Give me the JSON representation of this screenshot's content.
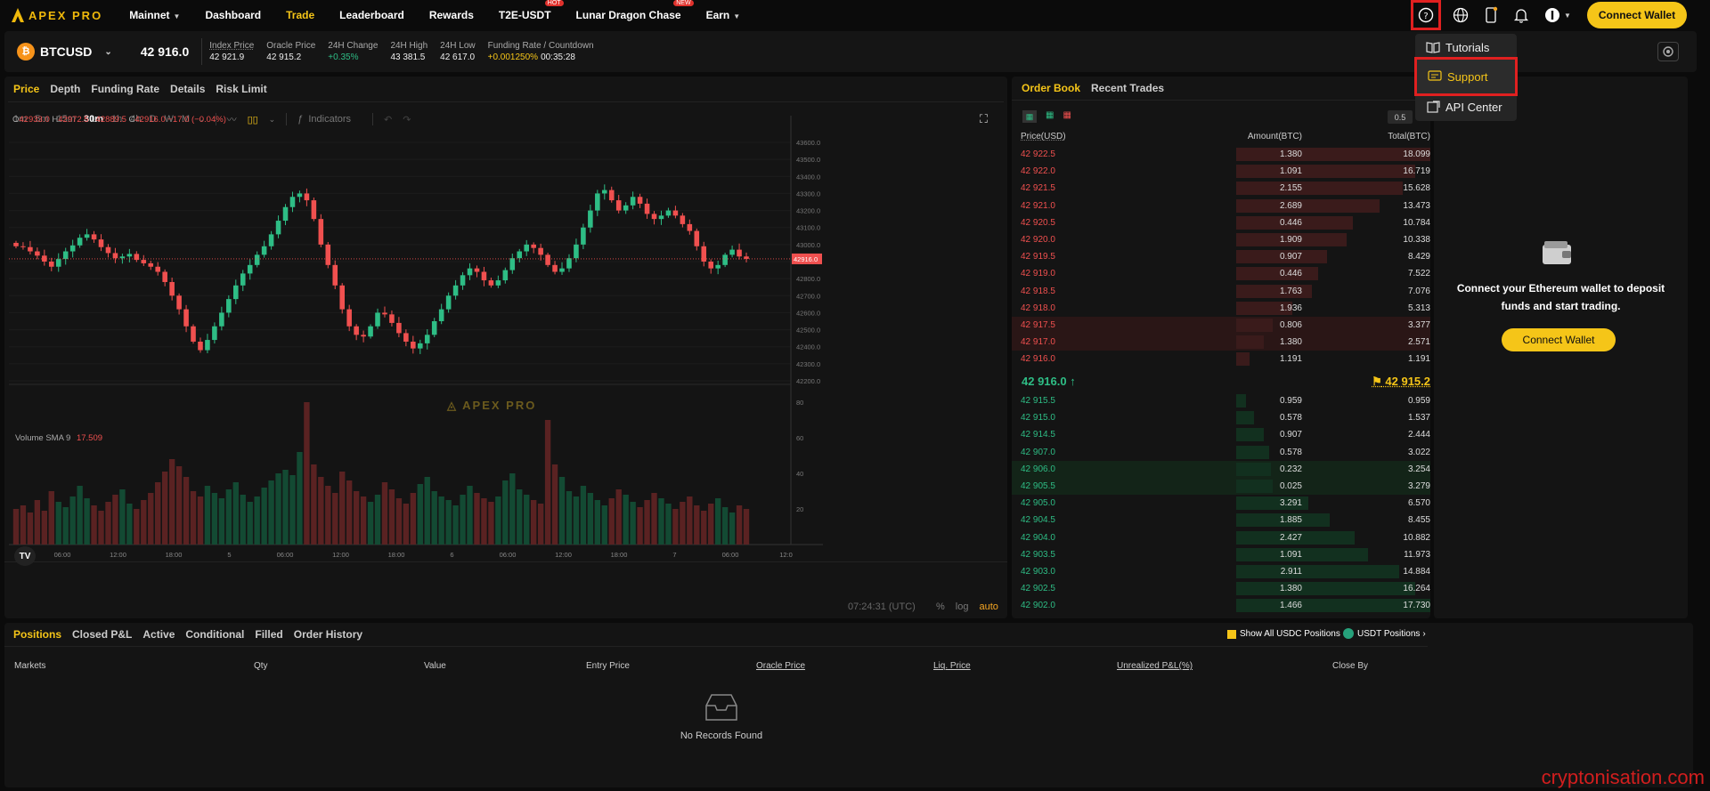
{
  "nav": {
    "logo": "APEX PRO",
    "items": [
      {
        "label": "Mainnet",
        "caret": true,
        "tag": ""
      },
      {
        "label": "Dashboard",
        "caret": false,
        "tag": ""
      },
      {
        "label": "Trade",
        "caret": false,
        "tag": "",
        "active": true
      },
      {
        "label": "Leaderboard",
        "caret": false,
        "tag": ""
      },
      {
        "label": "Rewards",
        "caret": false,
        "tag": ""
      },
      {
        "label": "T2E-USDT",
        "caret": false,
        "tag": "HOT"
      },
      {
        "label": "Lunar Dragon Chase",
        "caret": false,
        "tag": "NEW"
      },
      {
        "label": "Earn",
        "caret": true,
        "tag": ""
      }
    ],
    "connect_label": "Connect Wallet",
    "icons": [
      "help-icon",
      "globe-icon",
      "mobile-icon",
      "bell-icon",
      "account-icon"
    ]
  },
  "dropdown": {
    "items": [
      {
        "label": "Tutorials",
        "icon": "book-icon"
      },
      {
        "label": "Support",
        "icon": "message-icon",
        "highlighted": true
      },
      {
        "label": "API Center",
        "icon": "api-icon"
      }
    ]
  },
  "ticker": {
    "symbol": "BTCUSD",
    "coin_glyph": "₿",
    "last_price": "42 916.0",
    "stats": [
      {
        "label": "Index Price",
        "value": "42 921.9",
        "color": "#eeeeee",
        "dotted": true
      },
      {
        "label": "Oracle Price",
        "value": "42 915.2",
        "color": "#eeeeee",
        "dotted": false
      },
      {
        "label": "24H Change",
        "value": "+0.35%",
        "color": "#2ebd85",
        "dotted": false
      },
      {
        "label": "24H High",
        "value": "43 381.5",
        "color": "#eeeeee",
        "dotted": false
      },
      {
        "label": "24H Low",
        "value": "42 617.0",
        "color": "#eeeeee",
        "dotted": false
      },
      {
        "label": "Funding Rate / Countdown",
        "value": "+0.001250%",
        "value2": "00:35:28",
        "color": "#f5c518",
        "dotted": false
      }
    ]
  },
  "chart_panel": {
    "tabs": [
      "Price",
      "Depth",
      "Funding Rate",
      "Details",
      "Risk Limit"
    ],
    "intervals": [
      "1m",
      "5m",
      "15m",
      "30m",
      "1h",
      "4h",
      "D",
      "W",
      "M"
    ],
    "active_interval": "30m",
    "indicators_label": "Indicators",
    "ohlc": {
      "o": "42933.0",
      "h": "42972.5",
      "l": "42889.5",
      "c": "42916.0",
      "change": "−17.0 (−0.04%)"
    },
    "volume_label": "Volume SMA 9",
    "volume_value": "17.509",
    "watermark": "APEX PRO",
    "current_price_tag": "42916.0",
    "time_display": "07:24:31 (UTC)",
    "scale_options": [
      "%",
      "log",
      "auto"
    ]
  },
  "chart_data": {
    "type": "candlestick",
    "price_axis": [
      "43600.0",
      "43500.0",
      "43400.0",
      "43300.0",
      "43200.0",
      "43100.0",
      "43000.0",
      "42900.0",
      "42800.0",
      "42700.0",
      "42600.0",
      "42500.0",
      "42400.0",
      "42300.0",
      "42200.0"
    ],
    "volume_axis": [
      "80",
      "60",
      "40",
      "20"
    ],
    "time_axis": [
      "06:00",
      "12:00",
      "18:00",
      "5",
      "06:00",
      "12:00",
      "18:00",
      "6",
      "06:00",
      "12:00",
      "18:00",
      "7",
      "06:00",
      "12:0"
    ],
    "close_series": [
      42990,
      42985,
      42960,
      42935,
      42900,
      42870,
      42915,
      42960,
      42995,
      43040,
      43060,
      43030,
      42985,
      42950,
      42920,
      42930,
      42945,
      42910,
      42890,
      42870,
      42840,
      42780,
      42700,
      42620,
      42520,
      42430,
      42380,
      42440,
      42520,
      42600,
      42680,
      42760,
      42830,
      42880,
      42940,
      42990,
      43060,
      43140,
      43220,
      43280,
      43300,
      43260,
      43150,
      43000,
      42880,
      42760,
      42620,
      42520,
      42470,
      42460,
      42520,
      42600,
      42590,
      42540,
      42480,
      42430,
      42390,
      42420,
      42470,
      42550,
      42620,
      42700,
      42760,
      42820,
      42860,
      42840,
      42790,
      42760,
      42790,
      42850,
      42920,
      42960,
      43000,
      42980,
      42940,
      42880,
      42840,
      42860,
      42920,
      43000,
      43100,
      43200,
      43300,
      43320,
      43260,
      43200,
      43230,
      43280,
      43240,
      43180,
      43150,
      43170,
      43200,
      43170,
      43120,
      43080,
      42990,
      42900,
      42860,
      42880,
      42940,
      42970,
      42930,
      42916
    ],
    "volume_series": [
      20,
      22,
      18,
      25,
      19,
      30,
      24,
      21,
      27,
      33,
      26,
      22,
      19,
      24,
      28,
      31,
      23,
      20,
      25,
      29,
      35,
      41,
      48,
      44,
      38,
      30,
      27,
      33,
      29,
      26,
      31,
      35,
      28,
      24,
      27,
      32,
      36,
      40,
      42,
      39,
      52,
      80,
      45,
      38,
      33,
      29,
      41,
      36,
      30,
      27,
      24,
      28,
      35,
      31,
      26,
      23,
      29,
      34,
      38,
      30,
      27,
      25,
      22,
      28,
      33,
      29,
      26,
      24,
      27,
      36,
      40,
      31,
      28,
      25,
      23,
      70,
      45,
      38,
      30,
      27,
      33,
      29,
      25,
      22,
      26,
      31,
      28,
      24,
      21,
      25,
      29,
      26,
      23,
      20,
      24,
      27,
      22,
      19,
      23,
      26,
      21,
      18,
      22,
      20
    ]
  },
  "orderbook": {
    "tabs": [
      "Order Book",
      "Recent Trades"
    ],
    "step": "0.5",
    "headers": [
      "Price(USD)",
      "Amount(BTC)",
      "Total(BTC)"
    ],
    "asks": [
      {
        "price": "42 922.5",
        "amount": "1.380",
        "total": "18.099",
        "depth": 1.0
      },
      {
        "price": "42 922.0",
        "amount": "1.091",
        "total": "16.719",
        "depth": 0.92
      },
      {
        "price": "42 921.5",
        "amount": "2.155",
        "total": "15.628",
        "depth": 0.86
      },
      {
        "price": "42 921.0",
        "amount": "2.689",
        "total": "13.473",
        "depth": 0.74
      },
      {
        "price": "42 920.5",
        "amount": "0.446",
        "total": "10.784",
        "depth": 0.6
      },
      {
        "price": "42 920.0",
        "amount": "1.909",
        "total": "10.338",
        "depth": 0.57
      },
      {
        "price": "42 919.5",
        "amount": "0.907",
        "total": "8.429",
        "depth": 0.47
      },
      {
        "price": "42 919.0",
        "amount": "0.446",
        "total": "7.522",
        "depth": 0.42
      },
      {
        "price": "42 918.5",
        "amount": "1.763",
        "total": "7.076",
        "depth": 0.39
      },
      {
        "price": "42 918.0",
        "amount": "1.936",
        "total": "5.313",
        "depth": 0.29
      },
      {
        "price": "42 917.5",
        "amount": "0.806",
        "total": "3.377",
        "depth": 0.19
      },
      {
        "price": "42 917.0",
        "amount": "1.380",
        "total": "2.571",
        "depth": 0.14
      },
      {
        "price": "42 916.0",
        "amount": "1.191",
        "total": "1.191",
        "depth": 0.07
      }
    ],
    "mid_price": "42 916.0",
    "mid_arrow": "↑",
    "oracle_price": "42 915.2",
    "bids": [
      {
        "price": "42 915.5",
        "amount": "0.959",
        "total": "0.959",
        "depth": 0.05
      },
      {
        "price": "42 915.0",
        "amount": "0.578",
        "total": "1.537",
        "depth": 0.09
      },
      {
        "price": "42 914.5",
        "amount": "0.907",
        "total": "2.444",
        "depth": 0.14
      },
      {
        "price": "42 907.0",
        "amount": "0.578",
        "total": "3.022",
        "depth": 0.17
      },
      {
        "price": "42 906.0",
        "amount": "0.232",
        "total": "3.254",
        "depth": 0.18
      },
      {
        "price": "42 905.5",
        "amount": "0.025",
        "total": "3.279",
        "depth": 0.19
      },
      {
        "price": "42 905.0",
        "amount": "3.291",
        "total": "6.570",
        "depth": 0.37
      },
      {
        "price": "42 904.5",
        "amount": "1.885",
        "total": "8.455",
        "depth": 0.48
      },
      {
        "price": "42 904.0",
        "amount": "2.427",
        "total": "10.882",
        "depth": 0.61
      },
      {
        "price": "42 903.5",
        "amount": "1.091",
        "total": "11.973",
        "depth": 0.68
      },
      {
        "price": "42 903.0",
        "amount": "2.911",
        "total": "14.884",
        "depth": 0.84
      },
      {
        "price": "42 902.5",
        "amount": "1.380",
        "total": "16.264",
        "depth": 0.92
      },
      {
        "price": "42 902.0",
        "amount": "1.466",
        "total": "17.730",
        "depth": 1.0
      }
    ]
  },
  "wallet_panel": {
    "message": "Connect your Ethereum wallet to deposit funds and start trading.",
    "button": "Connect Wallet"
  },
  "positions": {
    "tabs": [
      "Positions",
      "Closed P&L",
      "Active",
      "Conditional",
      "Filled",
      "Order History"
    ],
    "show_all_label": "Show All USDC Positions",
    "usdt_label": "USDT Positions",
    "columns": [
      "Markets",
      "Qty",
      "Value",
      "Entry Price",
      "Oracle Price",
      "Liq. Price",
      "Unrealized P&L(%)",
      "Close By"
    ],
    "empty_text": "No Records Found"
  },
  "watermark_site": "cryptonisation.com",
  "colors": {
    "accent": "#f5c518",
    "red": "#f0504f",
    "green": "#2ebd85",
    "highlight": "#e02020"
  }
}
